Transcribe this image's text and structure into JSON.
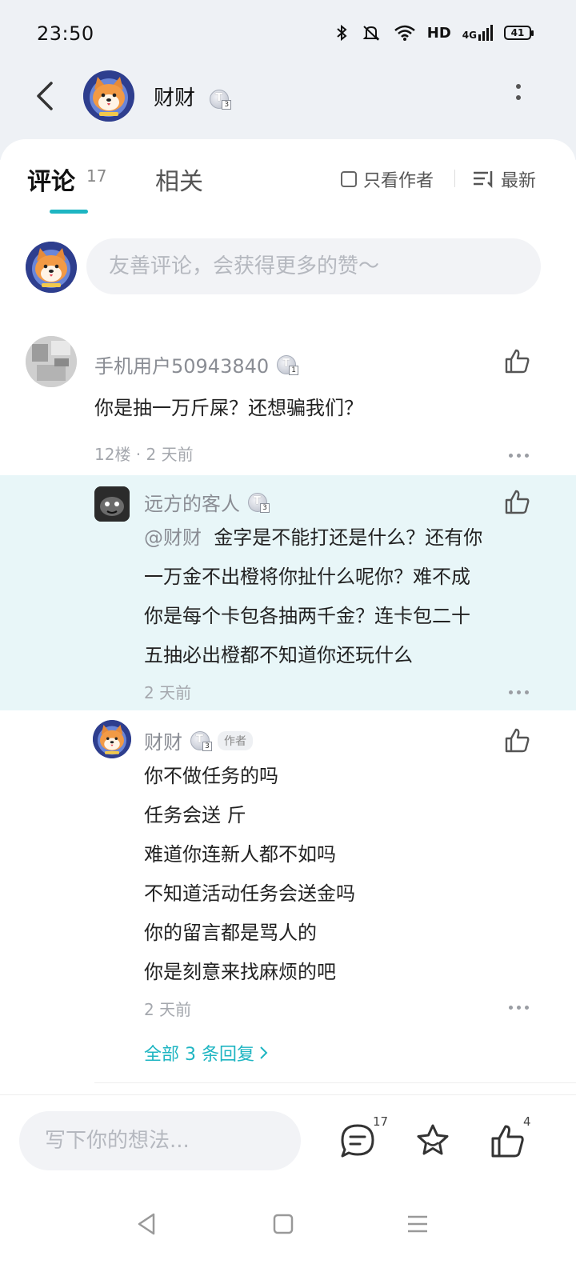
{
  "status_bar": {
    "time": "23:50",
    "network_label": "HD",
    "signal_label": "4G",
    "battery": "41"
  },
  "header": {
    "user_name": "财财",
    "level_badge": "T",
    "level_number": "3"
  },
  "tabs": {
    "comments_label": "评论",
    "comments_count": "17",
    "related_label": "相关",
    "only_author_label": "只看作者",
    "sort_label": "最新"
  },
  "compose": {
    "placeholder": "友善评论，会获得更多的赞～"
  },
  "comments": [
    {
      "user": "手机用户50943840",
      "level": "1",
      "text": "你是抽一万斤屎？还想骗我们？",
      "meta": "12楼 · 2 天前"
    },
    {
      "user": "远方的客人",
      "level": "3",
      "mention": "@财财",
      "text_lines": [
        "金字是不能打还是什么？还有你",
        "一万金不出橙将你扯什么呢你？难不成",
        "你是每个卡包各抽两千金？连卡包二十",
        "五抽必出橙都不知道你还玩什么"
      ],
      "meta": "2 天前"
    },
    {
      "user": "财财",
      "level": "3",
      "author_tag": "作者",
      "text_lines": [
        "你不做任务的吗",
        "任务会送 斤",
        "难道你连新人都不如吗",
        "不知道活动任务会送金吗",
        "你的留言都是骂人的",
        "你是刻意来找麻烦的吧"
      ],
      "meta": "2 天前"
    }
  ],
  "view_all_replies": "全部 3 条回复",
  "bottom_bar": {
    "placeholder": "写下你的想法...",
    "comment_count": "17",
    "like_count": "4"
  },
  "colors": {
    "accent": "#1eb5c2",
    "highlight_bg": "#e8f6f8",
    "top_bg": "#eef1f5"
  }
}
